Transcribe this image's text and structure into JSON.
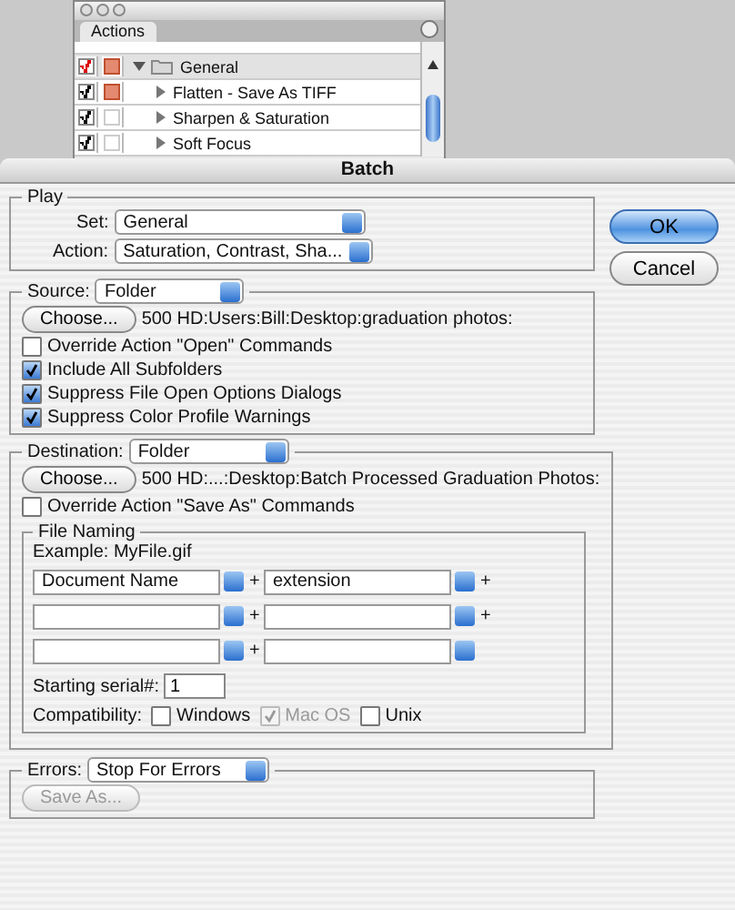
{
  "actions_panel": {
    "tab": "Actions",
    "rows": [
      {
        "kind": "set",
        "name": "General",
        "checked": true,
        "color": "#dd0000",
        "dialog_on": true,
        "expanded": true
      },
      {
        "kind": "action",
        "name": "Flatten - Save As TIFF",
        "checked": true,
        "color": "#000000",
        "dialog_on": true,
        "expanded": false
      },
      {
        "kind": "action",
        "name": "Sharpen & Saturation",
        "checked": true,
        "color": "#000000",
        "dialog_on": false,
        "expanded": false
      },
      {
        "kind": "action",
        "name": "Soft Focus",
        "checked": true,
        "color": "#000000",
        "dialog_on": false,
        "expanded": false
      }
    ]
  },
  "dialog": {
    "title": "Batch",
    "play": {
      "legend": "Play",
      "set_label": "Set:",
      "set_value": "General",
      "action_label": "Action:",
      "action_value": "Saturation, Contrast, Sha..."
    },
    "source": {
      "label": "Source:",
      "value": "Folder",
      "choose": "Choose...",
      "path": "500 HD:Users:Bill:Desktop:graduation photos:",
      "options": [
        {
          "label": "Override Action \"Open\" Commands",
          "checked": false
        },
        {
          "label": "Include All Subfolders",
          "checked": true
        },
        {
          "label": "Suppress File Open Options Dialogs",
          "checked": true
        },
        {
          "label": "Suppress Color Profile Warnings",
          "checked": true
        }
      ]
    },
    "destination": {
      "label": "Destination:",
      "value": "Folder",
      "choose": "Choose...",
      "path": "500 HD:...:Desktop:Batch Processed Graduation Photos:",
      "options": [
        {
          "label": "Override Action \"Save As\" Commands",
          "checked": false
        }
      ],
      "file_naming": {
        "legend": "File Naming",
        "example": "Example: MyFile.gif",
        "rows": [
          {
            "left": "Document Name",
            "join": "+",
            "right": "extension",
            "trail": "+"
          },
          {
            "join": "+",
            "trail": "+"
          },
          {
            "join": "+"
          }
        ],
        "serial_label": "Starting serial#:",
        "serial_value": "1",
        "compat_label": "Compatibility:",
        "compat": [
          {
            "label": "Windows",
            "checked": false,
            "disabled": false
          },
          {
            "label": "Mac OS",
            "checked": true,
            "disabled": true
          },
          {
            "label": "Unix",
            "checked": false,
            "disabled": false
          }
        ]
      }
    },
    "errors": {
      "label": "Errors:",
      "value": "Stop For Errors",
      "save_as": "Save As...",
      "save_as_disabled": true
    },
    "buttons": [
      {
        "label": "OK",
        "default": true
      },
      {
        "label": "Cancel",
        "default": false
      }
    ]
  }
}
